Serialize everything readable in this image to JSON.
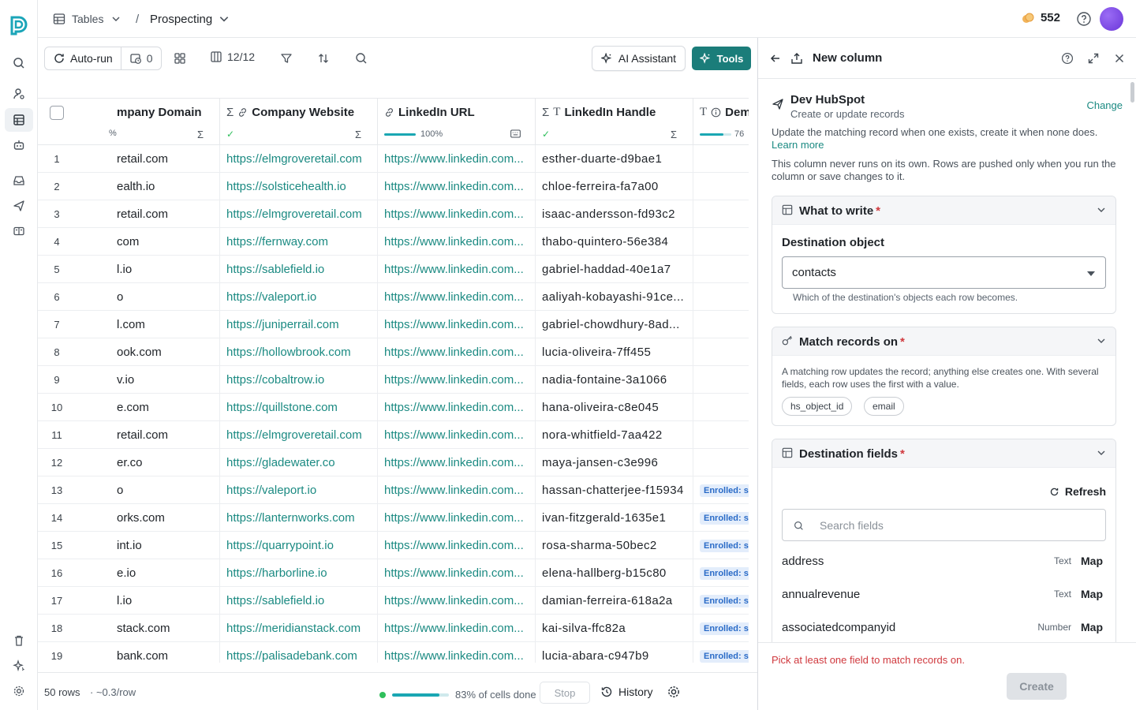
{
  "topbar": {
    "tables_label": "Tables",
    "separator": "/",
    "table_name": "Prospecting",
    "credits": "552"
  },
  "toolbar": {
    "autorun_label": "Auto-run",
    "schedule_count": "0",
    "columns_count": "12/12",
    "ai_label": "AI Assistant",
    "tools_label": "Tools"
  },
  "table": {
    "headers": [
      {
        "label": "mpany Domain",
        "sub": "%"
      },
      {
        "label": "Company Website",
        "sub": ""
      },
      {
        "label": "LinkedIn URL",
        "sub": "100%"
      },
      {
        "label": "LinkedIn Handle",
        "sub": ""
      },
      {
        "label": "Dem",
        "sub": "76"
      }
    ],
    "rows": [
      {
        "n": "1",
        "domain": "retail.com",
        "website": "https://elmgroveretail.com",
        "linkedin": "https://www.linkedin.com...",
        "handle": "esther-duarte-d9bae1",
        "dem": ""
      },
      {
        "n": "2",
        "domain": "ealth.io",
        "website": "https://solsticehealth.io",
        "linkedin": "https://www.linkedin.com...",
        "handle": "chloe-ferreira-fa7a00",
        "dem": ""
      },
      {
        "n": "3",
        "domain": "retail.com",
        "website": "https://elmgroveretail.com",
        "linkedin": "https://www.linkedin.com...",
        "handle": "isaac-andersson-fd93c2",
        "dem": ""
      },
      {
        "n": "4",
        "domain": "com",
        "website": "https://fernway.com",
        "linkedin": "https://www.linkedin.com...",
        "handle": "thabo-quintero-56e384",
        "dem": ""
      },
      {
        "n": "5",
        "domain": "l.io",
        "website": "https://sablefield.io",
        "linkedin": "https://www.linkedin.com...",
        "handle": "gabriel-haddad-40e1a7",
        "dem": ""
      },
      {
        "n": "6",
        "domain": "o",
        "website": "https://valeport.io",
        "linkedin": "https://www.linkedin.com...",
        "handle": "aaliyah-kobayashi-91ce...",
        "dem": ""
      },
      {
        "n": "7",
        "domain": "l.com",
        "website": "https://juniperrail.com",
        "linkedin": "https://www.linkedin.com...",
        "handle": "gabriel-chowdhury-8ad...",
        "dem": ""
      },
      {
        "n": "8",
        "domain": "ook.com",
        "website": "https://hollowbrook.com",
        "linkedin": "https://www.linkedin.com...",
        "handle": "lucia-oliveira-7ff455",
        "dem": ""
      },
      {
        "n": "9",
        "domain": "v.io",
        "website": "https://cobaltrow.io",
        "linkedin": "https://www.linkedin.com...",
        "handle": "nadia-fontaine-3a1066",
        "dem": ""
      },
      {
        "n": "10",
        "domain": "e.com",
        "website": "https://quillstone.com",
        "linkedin": "https://www.linkedin.com...",
        "handle": "hana-oliveira-c8e045",
        "dem": ""
      },
      {
        "n": "11",
        "domain": "retail.com",
        "website": "https://elmgroveretail.com",
        "linkedin": "https://www.linkedin.com...",
        "handle": "nora-whitfield-7aa422",
        "dem": ""
      },
      {
        "n": "12",
        "domain": "er.co",
        "website": "https://gladewater.co",
        "linkedin": "https://www.linkedin.com...",
        "handle": "maya-jansen-c3e996",
        "dem": ""
      },
      {
        "n": "13",
        "domain": "o",
        "website": "https://valeport.io",
        "linkedin": "https://www.linkedin.com...",
        "handle": "hassan-chatterjee-f15934",
        "dem": "Enrolled: sc"
      },
      {
        "n": "14",
        "domain": "orks.com",
        "website": "https://lanternworks.com",
        "linkedin": "https://www.linkedin.com...",
        "handle": "ivan-fitzgerald-1635e1",
        "dem": "Enrolled: sc"
      },
      {
        "n": "15",
        "domain": "int.io",
        "website": "https://quarrypoint.io",
        "linkedin": "https://www.linkedin.com...",
        "handle": "rosa-sharma-50bec2",
        "dem": "Enrolled: sc"
      },
      {
        "n": "16",
        "domain": "e.io",
        "website": "https://harborline.io",
        "linkedin": "https://www.linkedin.com...",
        "handle": "elena-hallberg-b15c80",
        "dem": "Enrolled: sc"
      },
      {
        "n": "17",
        "domain": "l.io",
        "website": "https://sablefield.io",
        "linkedin": "https://www.linkedin.com...",
        "handle": "damian-ferreira-618a2a",
        "dem": "Enrolled: sc"
      },
      {
        "n": "18",
        "domain": "stack.com",
        "website": "https://meridianstack.com",
        "linkedin": "https://www.linkedin.com...",
        "handle": "kai-silva-ffc82a",
        "dem": "Enrolled: sc"
      },
      {
        "n": "19",
        "domain": "bank.com",
        "website": "https://palisadebank.com",
        "linkedin": "https://www.linkedin.com...",
        "handle": "lucia-abara-c947b9",
        "dem": "Enrolled: sc"
      }
    ]
  },
  "footer": {
    "rows_label": "50 rows",
    "cost_label": "· ~0.3/row",
    "progress_text": "83% of cells done",
    "progress_fraction": 0.83,
    "stop_label": "Stop",
    "history_label": "History"
  },
  "panel": {
    "title": "New column",
    "destination_name": "Dev HubSpot",
    "destination_sub": "Create or update records",
    "change_label": "Change",
    "desc1": "Update the matching record when one exists, create it when none does.",
    "learn_more": "Learn more",
    "desc2": "This column never runs on its own. Rows are pushed only when you run the column or save changes to it.",
    "what_to_write": {
      "title": "What to write",
      "req": "*",
      "field_label": "Destination object",
      "value": "contacts",
      "helper": "Which of the destination's objects each row becomes."
    },
    "match": {
      "title": "Match records on",
      "req": "*",
      "desc": "A matching row updates the record; anything else creates one. With several fields, each row uses the first with a value.",
      "chips": [
        "hs_object_id",
        "email"
      ]
    },
    "fields": {
      "title": "Destination fields",
      "req": "*",
      "refresh_label": "Refresh",
      "search_placeholder": "Search fields",
      "map_label": "Map",
      "items": [
        {
          "name": "address",
          "type": "Text"
        },
        {
          "name": "annualrevenue",
          "type": "Text"
        },
        {
          "name": "associatedcompanyid",
          "type": "Number"
        }
      ]
    },
    "error": "Pick at least one field to match records on.",
    "create_label": "Create"
  },
  "colors": {
    "accent": "#1b7d7a",
    "link": "#1b8a82",
    "error": "#d0393e",
    "badge_bg": "#e3edfb"
  }
}
